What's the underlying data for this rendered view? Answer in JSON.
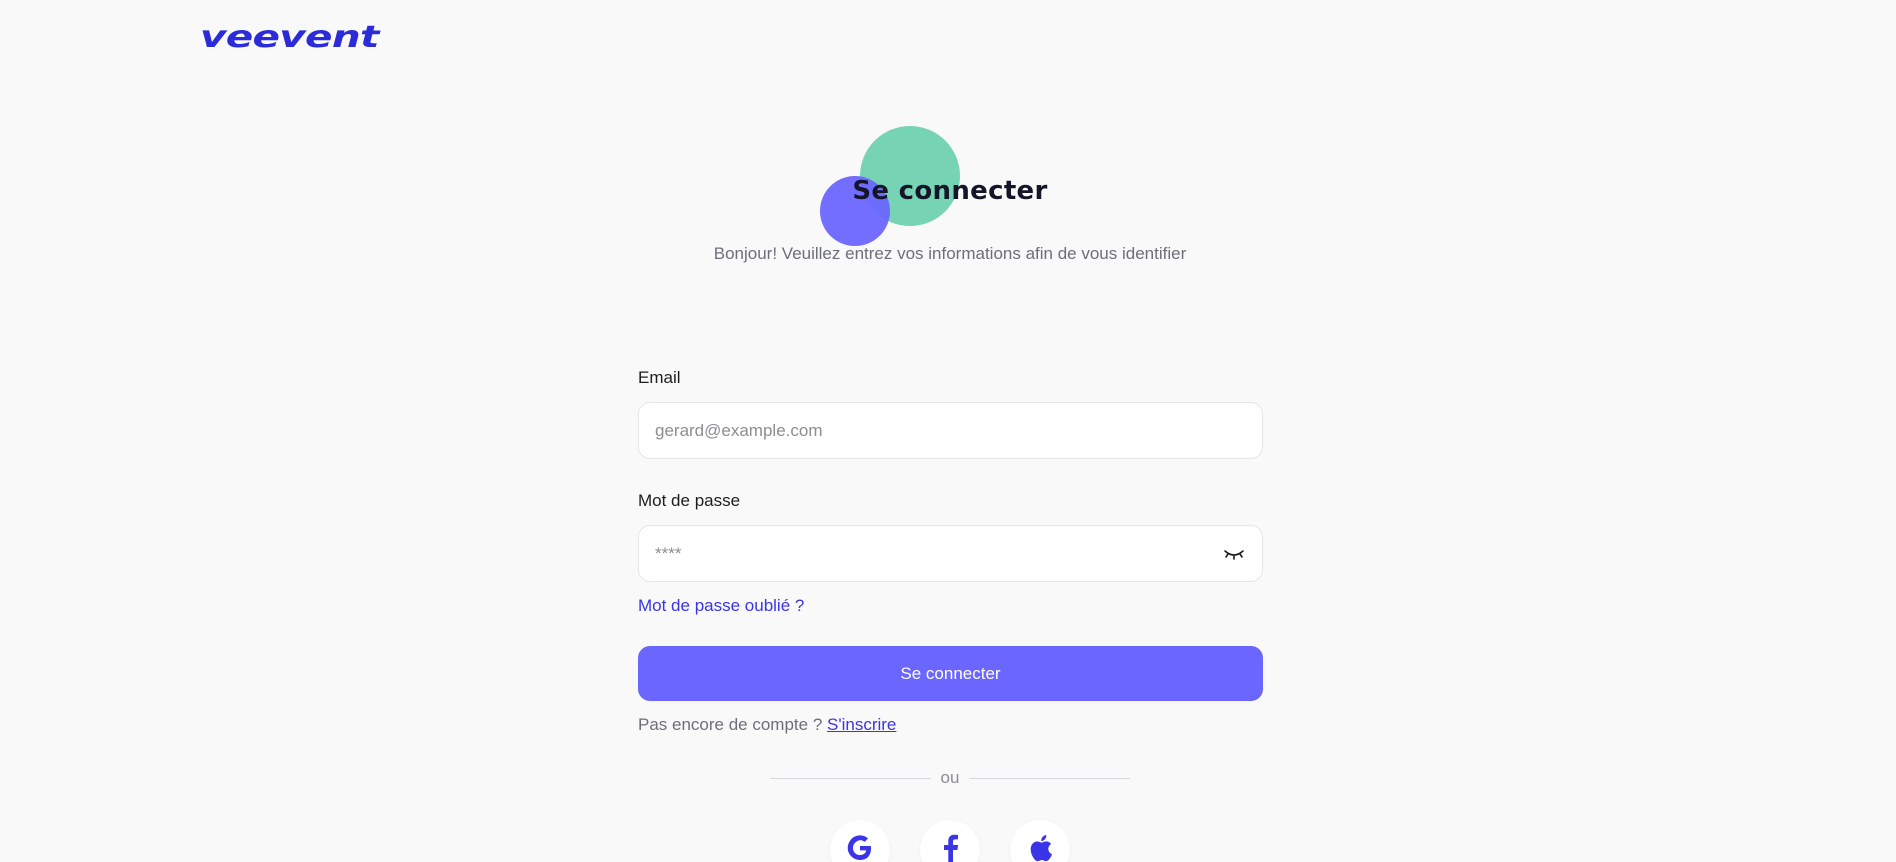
{
  "brand": {
    "logo_text": "veevent",
    "accent": "#6b66ff",
    "link_color": "#3a35e6"
  },
  "header": {
    "title": "Se connecter",
    "subtitle": "Bonjour! Veuillez entrez vos informations afin de vous identifier"
  },
  "form": {
    "email_label": "Email",
    "email_placeholder": "gerard@example.com",
    "email_value": "",
    "password_label": "Mot de passe",
    "password_placeholder": "****",
    "password_value": "",
    "password_toggle_icon": "eye-closed-icon",
    "forgot_link": "Mot de passe oublié ?",
    "submit_label": "Se connecter",
    "signup_prompt": "Pas encore de compte ?",
    "signup_link": "S'inscrire"
  },
  "divider": {
    "label": "ou"
  },
  "social_login": [
    {
      "name": "google",
      "icon": "google-icon"
    },
    {
      "name": "facebook",
      "icon": "facebook-icon"
    },
    {
      "name": "apple",
      "icon": "apple-icon"
    }
  ]
}
